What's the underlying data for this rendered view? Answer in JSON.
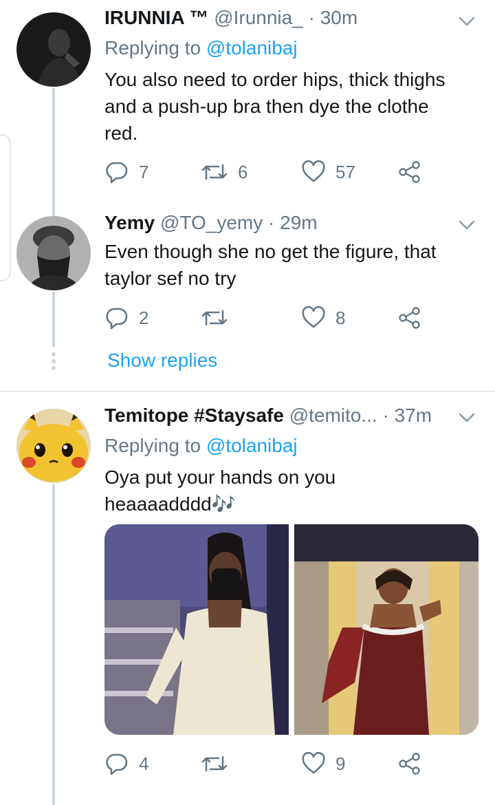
{
  "tweets": [
    {
      "name": "IRUNNIA ™",
      "handle": "@Irunnia_",
      "time": "30m",
      "replying_label": "Replying to",
      "replying_to": "@tolanibaj",
      "lines": [
        "You also need to order hips, thick thighs",
        "and a push-up bra then dye the clothe",
        "red."
      ],
      "reply_count": "7",
      "retweet_count": "6",
      "like_count": "57"
    },
    {
      "name": "Yemy",
      "handle": "@TO_yemy",
      "time": "29m",
      "lines": [
        "Even though she no get the figure, that",
        "taylor sef no try"
      ],
      "reply_count": "2",
      "retweet_count": "",
      "like_count": "8",
      "show_replies": "Show replies"
    },
    {
      "name": "Temitope #Staysafe",
      "handle": "@temito...",
      "time": "37m",
      "replying_label": "Replying to",
      "replying_to": "@tolanibaj",
      "lines": [
        "Oya put your hands on you",
        "heaaaadddd🎶"
      ],
      "reply_count": "4",
      "retweet_count": "",
      "like_count": "9"
    }
  ],
  "separator": "·",
  "icons": [
    "reply-icon",
    "retweet-icon",
    "like-icon",
    "share-icon",
    "chevron-down-icon"
  ],
  "colors": {
    "accent": "#1da1f2",
    "muted": "#657786",
    "text": "#14171a",
    "divider": "#e6ecf0"
  }
}
